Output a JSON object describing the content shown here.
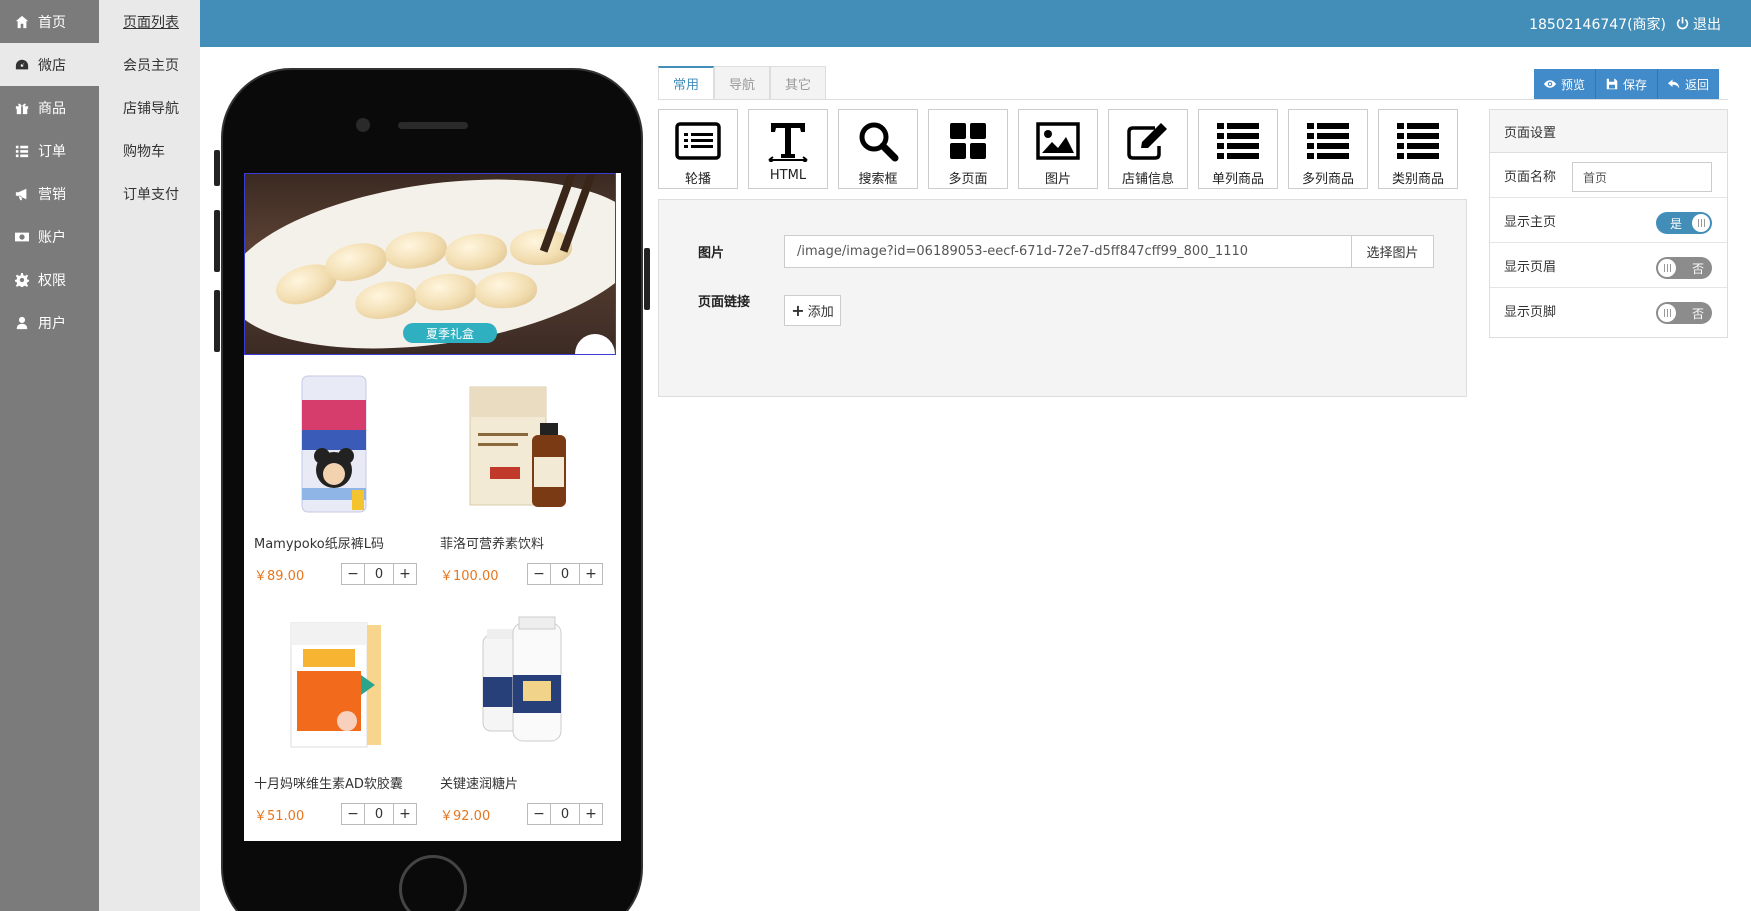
{
  "sidebar": {
    "items": [
      {
        "label": "首页",
        "icon": "home-icon"
      },
      {
        "label": "微店",
        "icon": "dashboard-icon"
      },
      {
        "label": "商品",
        "icon": "gift-icon"
      },
      {
        "label": "订单",
        "icon": "list-icon"
      },
      {
        "label": "营销",
        "icon": "bullhorn-icon"
      },
      {
        "label": "账户",
        "icon": "money-icon"
      },
      {
        "label": "权限",
        "icon": "gear-icon"
      },
      {
        "label": "用户",
        "icon": "user-icon"
      }
    ],
    "active_index": 1
  },
  "subnav": {
    "items": [
      "页面列表",
      "会员主页",
      "店铺导航",
      "购物车",
      "订单支付"
    ],
    "active_index": 0
  },
  "topbar": {
    "user": "18502146747(商家)",
    "logout_label": "退出",
    "color": "#438eb9"
  },
  "phone": {
    "banner_tag": "夏季礼盒",
    "products": [
      {
        "name": "Mamypoko纸尿裤L码",
        "price": "￥89.00",
        "qty": "0"
      },
      {
        "name": "菲洛可营养素饮料",
        "price": "￥100.00",
        "qty": "0"
      },
      {
        "name": "十月妈咪维生素AD软胶囊",
        "price": "￥51.00",
        "qty": "0"
      },
      {
        "name": "关键速润糖片",
        "price": "￥92.00",
        "qty": "0"
      }
    ],
    "stepper_minus": "−",
    "stepper_plus": "+"
  },
  "tabs": [
    "常用",
    "导航",
    "其它"
  ],
  "tabs_active_index": 0,
  "actions": {
    "preview": "预览",
    "save": "保存",
    "back": "返回"
  },
  "widgets": [
    {
      "label": "轮播",
      "icon": "carousel-icon"
    },
    {
      "label": "HTML",
      "icon": "text-icon"
    },
    {
      "label": "搜索框",
      "icon": "search-icon"
    },
    {
      "label": "多页面",
      "icon": "grid-icon"
    },
    {
      "label": "图片",
      "icon": "image-icon"
    },
    {
      "label": "店铺信息",
      "icon": "edit-icon"
    },
    {
      "label": "单列商品",
      "icon": "list-icon"
    },
    {
      "label": "多列商品",
      "icon": "list-icon"
    },
    {
      "label": "类别商品",
      "icon": "list-icon"
    }
  ],
  "form": {
    "image_label": "图片",
    "image_value": "/image/image?id=06189053-eecf-671d-72e7-d5ff847cff99_800_1110",
    "pick_label": "选择图片",
    "link_label": "页面链接",
    "add_label": "添加"
  },
  "settings": {
    "title": "页面设置",
    "page_name_label": "页面名称",
    "page_name_value": "首页",
    "show_home_label": "显示主页",
    "show_home_value": "是",
    "show_header_label": "显示页眉",
    "show_header_value": "否",
    "show_footer_label": "显示页脚",
    "show_footer_value": "否"
  }
}
